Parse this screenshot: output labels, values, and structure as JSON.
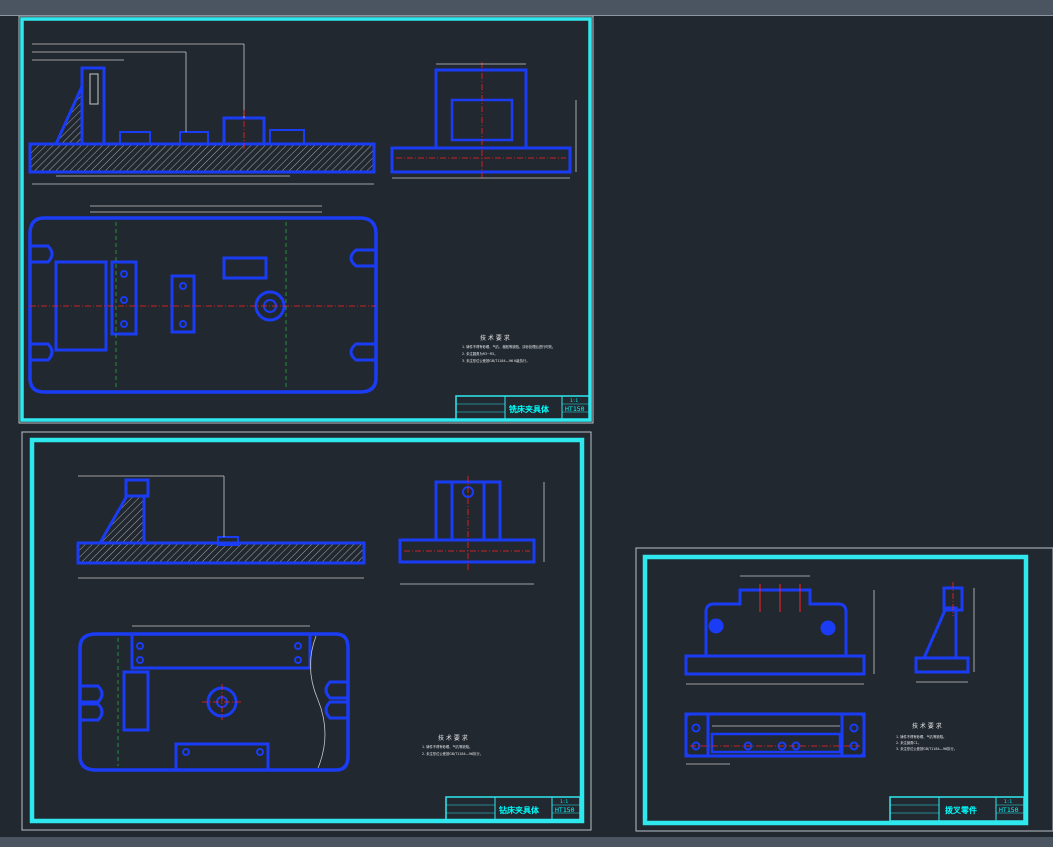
{
  "app": {
    "background": "#212830",
    "chrome_color": "#4b5562"
  },
  "colors": {
    "frame": "#2fe8ee",
    "part": "#1a3cf5",
    "center_line": "#ff2020",
    "hidden_line": "#27a83a",
    "dimension": "#c8c8c8",
    "text": "#00ffff"
  },
  "sheets": [
    {
      "id": "sheet-1",
      "title_block": {
        "title": "铣床夹具体",
        "material": "HT150",
        "scale": "1:1"
      },
      "notes": {
        "heading": "技 术 要 求",
        "lines": [
          "1. 铸件不得有砂眼、气孔、缩松等缺陷，清砂处理后进行时效。",
          "2. 未注圆角为R3~R5。",
          "3. 未注形位公差按GB/T1184—96 K级执行。"
        ]
      }
    },
    {
      "id": "sheet-2",
      "title_block": {
        "title": "钻床夹具体",
        "material": "HT150",
        "scale": "1:1"
      },
      "notes": {
        "heading": "技 术 要 求",
        "lines": [
          "1. 铸件不得有砂眼、气孔等缺陷。",
          "2. 未注形位公差按GB/T1184—96执行。"
        ]
      }
    },
    {
      "id": "sheet-3",
      "title_block": {
        "title": "拨叉零件",
        "material": "HT150",
        "scale": "1:1"
      },
      "notes": {
        "heading": "技 术 要 求",
        "lines": [
          "1. 铸件不得有砂眼、气孔等缺陷。",
          "2. 未注倒角C1。",
          "3. 未注形位公差按GB/T1184—96执行。"
        ]
      }
    }
  ]
}
